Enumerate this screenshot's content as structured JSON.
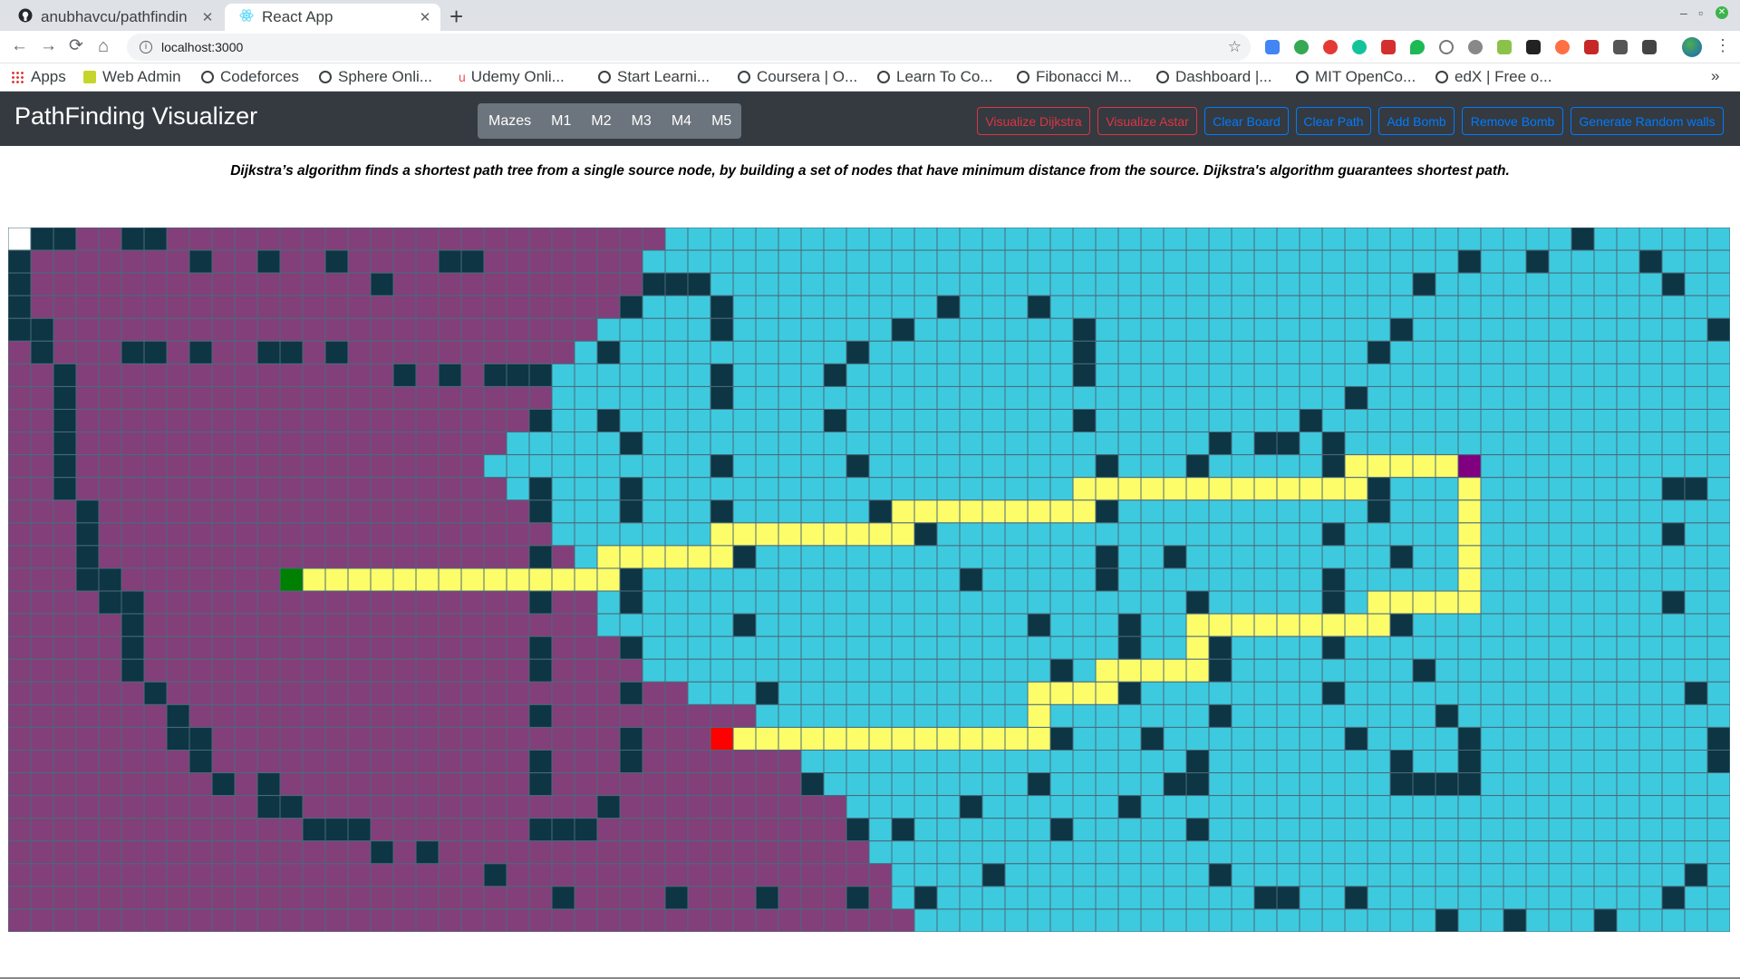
{
  "browser": {
    "tabs": [
      {
        "title": "anubhavcu/pathfindin",
        "icon": "github-icon",
        "active": false
      },
      {
        "title": "React App",
        "icon": "react-icon",
        "active": true
      }
    ],
    "url": "localhost:3000",
    "bookmarks": [
      "Apps",
      "Web Admin",
      "Codeforces",
      "Sphere Onli...",
      "Udemy Onli...",
      "Start Learni...",
      "Coursera | O...",
      "Learn To Co...",
      "Fibonacci M...",
      "Dashboard |...",
      "MIT OpenCo...",
      "edX | Free o..."
    ]
  },
  "app": {
    "title": "PathFinding Visualizer",
    "maze_buttons": [
      "Mazes",
      "M1",
      "M2",
      "M3",
      "M4",
      "M5"
    ],
    "actions": {
      "visualize_dijkstra": "Visualize Dijkstra",
      "visualize_astar": "Visualize Astar",
      "clear_board": "Clear Board",
      "clear_path": "Clear Path",
      "add_bomb": "Add Bomb",
      "remove_bomb": "Remove Bomb",
      "random_walls": "Generate Random walls"
    },
    "description": "Dijkstra’s algorithm finds a shortest path tree from a single source node, by building a set of nodes that have minimum distance from the source. Dijkstra's algorithm guarantees shortest path."
  },
  "grid": {
    "cols": 76,
    "rows": 31,
    "colors": {
      "unvisited": "#ffffff",
      "visited_first": "#833f7a",
      "visited_second": "#3dcadf",
      "wall": "#0d3543",
      "path": "#fdfd6a",
      "start": "#008000",
      "bomb": "#800080",
      "target": "#ff0000"
    },
    "start": [
      12,
      15
    ],
    "target": [
      31,
      22
    ],
    "bomb": [
      64,
      10
    ],
    "first_phase_boundary": [
      29,
      28,
      28,
      27,
      26,
      25,
      24,
      24,
      23,
      22,
      21,
      22,
      23,
      24,
      25,
      25,
      26,
      26,
      28,
      28,
      30,
      33,
      34,
      35,
      36,
      37,
      37,
      38,
      39,
      39,
      40
    ],
    "walls": [
      [
        1,
        0
      ],
      [
        2,
        0
      ],
      [
        5,
        0
      ],
      [
        6,
        0
      ],
      [
        69,
        0
      ],
      [
        0,
        1
      ],
      [
        8,
        1
      ],
      [
        11,
        1
      ],
      [
        14,
        1
      ],
      [
        19,
        1
      ],
      [
        20,
        1
      ],
      [
        64,
        1
      ],
      [
        67,
        1
      ],
      [
        72,
        1
      ],
      [
        0,
        2
      ],
      [
        16,
        2
      ],
      [
        28,
        2
      ],
      [
        29,
        2
      ],
      [
        30,
        2
      ],
      [
        62,
        2
      ],
      [
        73,
        2
      ],
      [
        0,
        3
      ],
      [
        27,
        3
      ],
      [
        31,
        3
      ],
      [
        41,
        3
      ],
      [
        45,
        3
      ],
      [
        0,
        4
      ],
      [
        1,
        4
      ],
      [
        31,
        4
      ],
      [
        39,
        4
      ],
      [
        47,
        4
      ],
      [
        61,
        4
      ],
      [
        75,
        4
      ],
      [
        1,
        5
      ],
      [
        5,
        5
      ],
      [
        6,
        5
      ],
      [
        8,
        5
      ],
      [
        11,
        5
      ],
      [
        12,
        5
      ],
      [
        14,
        5
      ],
      [
        26,
        5
      ],
      [
        37,
        5
      ],
      [
        47,
        5
      ],
      [
        60,
        5
      ],
      [
        2,
        6
      ],
      [
        17,
        6
      ],
      [
        19,
        6
      ],
      [
        21,
        6
      ],
      [
        22,
        6
      ],
      [
        23,
        6
      ],
      [
        31,
        6
      ],
      [
        36,
        6
      ],
      [
        47,
        6
      ],
      [
        2,
        7
      ],
      [
        31,
        7
      ],
      [
        59,
        7
      ],
      [
        2,
        8
      ],
      [
        23,
        8
      ],
      [
        26,
        8
      ],
      [
        36,
        8
      ],
      [
        47,
        8
      ],
      [
        57,
        8
      ],
      [
        2,
        9
      ],
      [
        27,
        9
      ],
      [
        53,
        9
      ],
      [
        55,
        9
      ],
      [
        56,
        9
      ],
      [
        58,
        9
      ],
      [
        2,
        10
      ],
      [
        31,
        10
      ],
      [
        37,
        10
      ],
      [
        48,
        10
      ],
      [
        52,
        10
      ],
      [
        58,
        10
      ],
      [
        2,
        11
      ],
      [
        23,
        11
      ],
      [
        27,
        11
      ],
      [
        60,
        11
      ],
      [
        73,
        11
      ],
      [
        74,
        11
      ],
      [
        3,
        12
      ],
      [
        23,
        12
      ],
      [
        27,
        12
      ],
      [
        31,
        12
      ],
      [
        38,
        12
      ],
      [
        48,
        12
      ],
      [
        60,
        12
      ],
      [
        3,
        13
      ],
      [
        40,
        13
      ],
      [
        58,
        13
      ],
      [
        73,
        13
      ],
      [
        3,
        14
      ],
      [
        23,
        14
      ],
      [
        32,
        14
      ],
      [
        48,
        14
      ],
      [
        51,
        14
      ],
      [
        61,
        14
      ],
      [
        3,
        15
      ],
      [
        4,
        15
      ],
      [
        27,
        15
      ],
      [
        42,
        15
      ],
      [
        48,
        15
      ],
      [
        58,
        15
      ],
      [
        4,
        16
      ],
      [
        5,
        16
      ],
      [
        23,
        16
      ],
      [
        27,
        16
      ],
      [
        52,
        16
      ],
      [
        58,
        16
      ],
      [
        73,
        16
      ],
      [
        5,
        17
      ],
      [
        32,
        17
      ],
      [
        45,
        17
      ],
      [
        49,
        17
      ],
      [
        61,
        17
      ],
      [
        5,
        18
      ],
      [
        27,
        18
      ],
      [
        23,
        18
      ],
      [
        49,
        18
      ],
      [
        53,
        18
      ],
      [
        58,
        18
      ],
      [
        5,
        19
      ],
      [
        23,
        19
      ],
      [
        46,
        19
      ],
      [
        53,
        19
      ],
      [
        62,
        19
      ],
      [
        6,
        20
      ],
      [
        27,
        20
      ],
      [
        33,
        20
      ],
      [
        49,
        20
      ],
      [
        58,
        20
      ],
      [
        74,
        20
      ],
      [
        7,
        21
      ],
      [
        23,
        21
      ],
      [
        53,
        21
      ],
      [
        63,
        21
      ],
      [
        7,
        22
      ],
      [
        8,
        22
      ],
      [
        27,
        22
      ],
      [
        46,
        22
      ],
      [
        50,
        22
      ],
      [
        59,
        22
      ],
      [
        64,
        22
      ],
      [
        75,
        22
      ],
      [
        8,
        23
      ],
      [
        23,
        23
      ],
      [
        27,
        23
      ],
      [
        52,
        23
      ],
      [
        61,
        23
      ],
      [
        64,
        23
      ],
      [
        75,
        23
      ],
      [
        9,
        24
      ],
      [
        11,
        24
      ],
      [
        23,
        24
      ],
      [
        35,
        24
      ],
      [
        45,
        24
      ],
      [
        51,
        24
      ],
      [
        52,
        24
      ],
      [
        61,
        24
      ],
      [
        62,
        24
      ],
      [
        63,
        24
      ],
      [
        64,
        24
      ],
      [
        11,
        25
      ],
      [
        12,
        25
      ],
      [
        26,
        25
      ],
      [
        42,
        25
      ],
      [
        49,
        25
      ],
      [
        13,
        26
      ],
      [
        14,
        26
      ],
      [
        15,
        26
      ],
      [
        23,
        26
      ],
      [
        24,
        26
      ],
      [
        25,
        26
      ],
      [
        37,
        26
      ],
      [
        39,
        26
      ],
      [
        46,
        26
      ],
      [
        52,
        26
      ],
      [
        16,
        27
      ],
      [
        18,
        27
      ],
      [
        21,
        28
      ],
      [
        43,
        28
      ],
      [
        53,
        28
      ],
      [
        74,
        28
      ],
      [
        24,
        29
      ],
      [
        29,
        29
      ],
      [
        33,
        29
      ],
      [
        37,
        29
      ],
      [
        40,
        29
      ],
      [
        55,
        29
      ],
      [
        56,
        29
      ],
      [
        59,
        29
      ],
      [
        73,
        29
      ],
      [
        63,
        30
      ],
      [
        66,
        30
      ],
      [
        70,
        30
      ]
    ],
    "path": [
      [
        13,
        15
      ],
      [
        14,
        15
      ],
      [
        15,
        15
      ],
      [
        16,
        15
      ],
      [
        17,
        15
      ],
      [
        18,
        15
      ],
      [
        19,
        15
      ],
      [
        20,
        15
      ],
      [
        21,
        15
      ],
      [
        22,
        15
      ],
      [
        23,
        15
      ],
      [
        24,
        15
      ],
      [
        25,
        15
      ],
      [
        26,
        15
      ],
      [
        26,
        14
      ],
      [
        27,
        14
      ],
      [
        28,
        14
      ],
      [
        29,
        14
      ],
      [
        30,
        14
      ],
      [
        31,
        14
      ],
      [
        31,
        13
      ],
      [
        32,
        13
      ],
      [
        33,
        13
      ],
      [
        34,
        13
      ],
      [
        35,
        13
      ],
      [
        36,
        13
      ],
      [
        37,
        13
      ],
      [
        38,
        13
      ],
      [
        39,
        13
      ],
      [
        39,
        12
      ],
      [
        40,
        12
      ],
      [
        41,
        12
      ],
      [
        42,
        12
      ],
      [
        43,
        12
      ],
      [
        44,
        12
      ],
      [
        45,
        12
      ],
      [
        46,
        12
      ],
      [
        47,
        12
      ],
      [
        47,
        11
      ],
      [
        48,
        11
      ],
      [
        49,
        11
      ],
      [
        50,
        11
      ],
      [
        51,
        11
      ],
      [
        52,
        11
      ],
      [
        53,
        11
      ],
      [
        54,
        11
      ],
      [
        55,
        11
      ],
      [
        56,
        11
      ],
      [
        57,
        11
      ],
      [
        58,
        11
      ],
      [
        59,
        11
      ],
      [
        59,
        10
      ],
      [
        60,
        10
      ],
      [
        61,
        10
      ],
      [
        62,
        10
      ],
      [
        63,
        10
      ],
      [
        64,
        11
      ],
      [
        64,
        12
      ],
      [
        64,
        13
      ],
      [
        64,
        14
      ],
      [
        64,
        15
      ],
      [
        64,
        16
      ],
      [
        63,
        16
      ],
      [
        62,
        16
      ],
      [
        61,
        16
      ],
      [
        60,
        16
      ],
      [
        60,
        17
      ],
      [
        59,
        17
      ],
      [
        58,
        17
      ],
      [
        57,
        17
      ],
      [
        56,
        17
      ],
      [
        55,
        17
      ],
      [
        54,
        17
      ],
      [
        53,
        17
      ],
      [
        52,
        17
      ],
      [
        52,
        18
      ],
      [
        52,
        19
      ],
      [
        51,
        19
      ],
      [
        50,
        19
      ],
      [
        49,
        19
      ],
      [
        48,
        19
      ],
      [
        48,
        20
      ],
      [
        47,
        20
      ],
      [
        46,
        20
      ],
      [
        45,
        20
      ],
      [
        45,
        21
      ],
      [
        45,
        22
      ],
      [
        44,
        22
      ],
      [
        43,
        22
      ],
      [
        42,
        22
      ],
      [
        41,
        22
      ],
      [
        40,
        22
      ],
      [
        39,
        22
      ],
      [
        38,
        22
      ],
      [
        37,
        22
      ],
      [
        36,
        22
      ],
      [
        35,
        22
      ],
      [
        34,
        22
      ],
      [
        33,
        22
      ],
      [
        32,
        22
      ]
    ]
  }
}
